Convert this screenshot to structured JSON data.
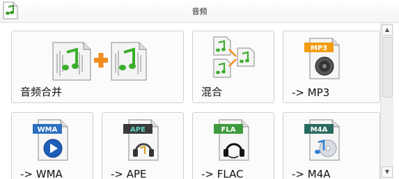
{
  "window": {
    "title": "音频"
  },
  "tiles": [
    {
      "label": "音频合并",
      "icon": "merge-audio-icon"
    },
    {
      "label": "混合",
      "icon": "mix-audio-icon"
    },
    {
      "label": "-> MP3",
      "icon": "mp3-file-icon",
      "badge": "MP3",
      "badge_color": "#f39c12"
    },
    {
      "label": "-> WMA",
      "icon": "wma-file-icon",
      "badge": "WMA",
      "badge_color": "#2c6fbe"
    },
    {
      "label": "-> APE",
      "icon": "ape-file-icon",
      "badge": "APE",
      "badge_color": "#3a3a3a"
    },
    {
      "label": "-> FLAC",
      "icon": "flac-file-icon",
      "badge": "FLA",
      "badge_color": "#3e9a3e"
    },
    {
      "label": "-> M4A",
      "icon": "m4a-file-icon",
      "badge": "M4A",
      "badge_color": "#2a6b5f"
    }
  ],
  "scrollbar": {
    "up": "▲",
    "down": "▼"
  }
}
